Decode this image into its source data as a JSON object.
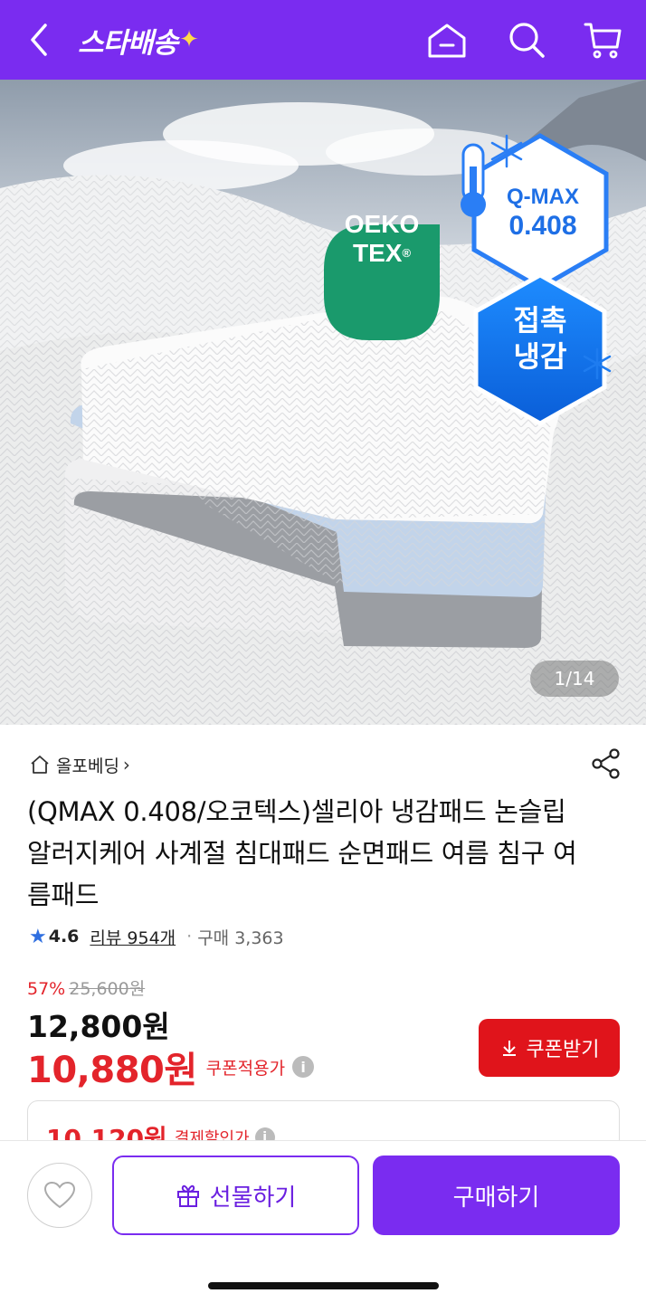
{
  "header": {
    "logo_text": "스타배송",
    "logo_spark": "✦",
    "icons": [
      "back-icon",
      "home-icon",
      "search-icon",
      "cart-icon"
    ],
    "bg_color": "#7a2cf0"
  },
  "hero": {
    "badge_oeko_line1": "OEKO",
    "badge_oeko_line2": "TEX",
    "badge_oeko_mark": "®",
    "badge_qmax_label": "Q-MAX",
    "badge_qmax_value": "0.408",
    "badge_cool_line1": "접촉",
    "badge_cool_line2": "냉감",
    "pager": "1/14"
  },
  "product": {
    "store_name": "올포베딩",
    "store_chevron": "›",
    "title": "(QMAX 0.408/오코텍스)셀리아 냉감패드 논슬립 알러지케어 사계절 침대패드 순면패드 여름 침구 여름패드",
    "rating_score": "4.6",
    "review_text": "리뷰 954개",
    "purchase_text": "구매 3,363",
    "discount_pct": "57%",
    "original_price": "25,600원",
    "sale_price": "12,800원",
    "coupon_price": "10,880원",
    "coupon_label": "쿠폰적용가",
    "coupon_button": "쿠폰받기",
    "pay_price": "10,120원",
    "pay_label": "결제할인가",
    "info_glyph": "i"
  },
  "bottom_bar": {
    "gift_label": "선물하기",
    "buy_label": "구매하기"
  }
}
